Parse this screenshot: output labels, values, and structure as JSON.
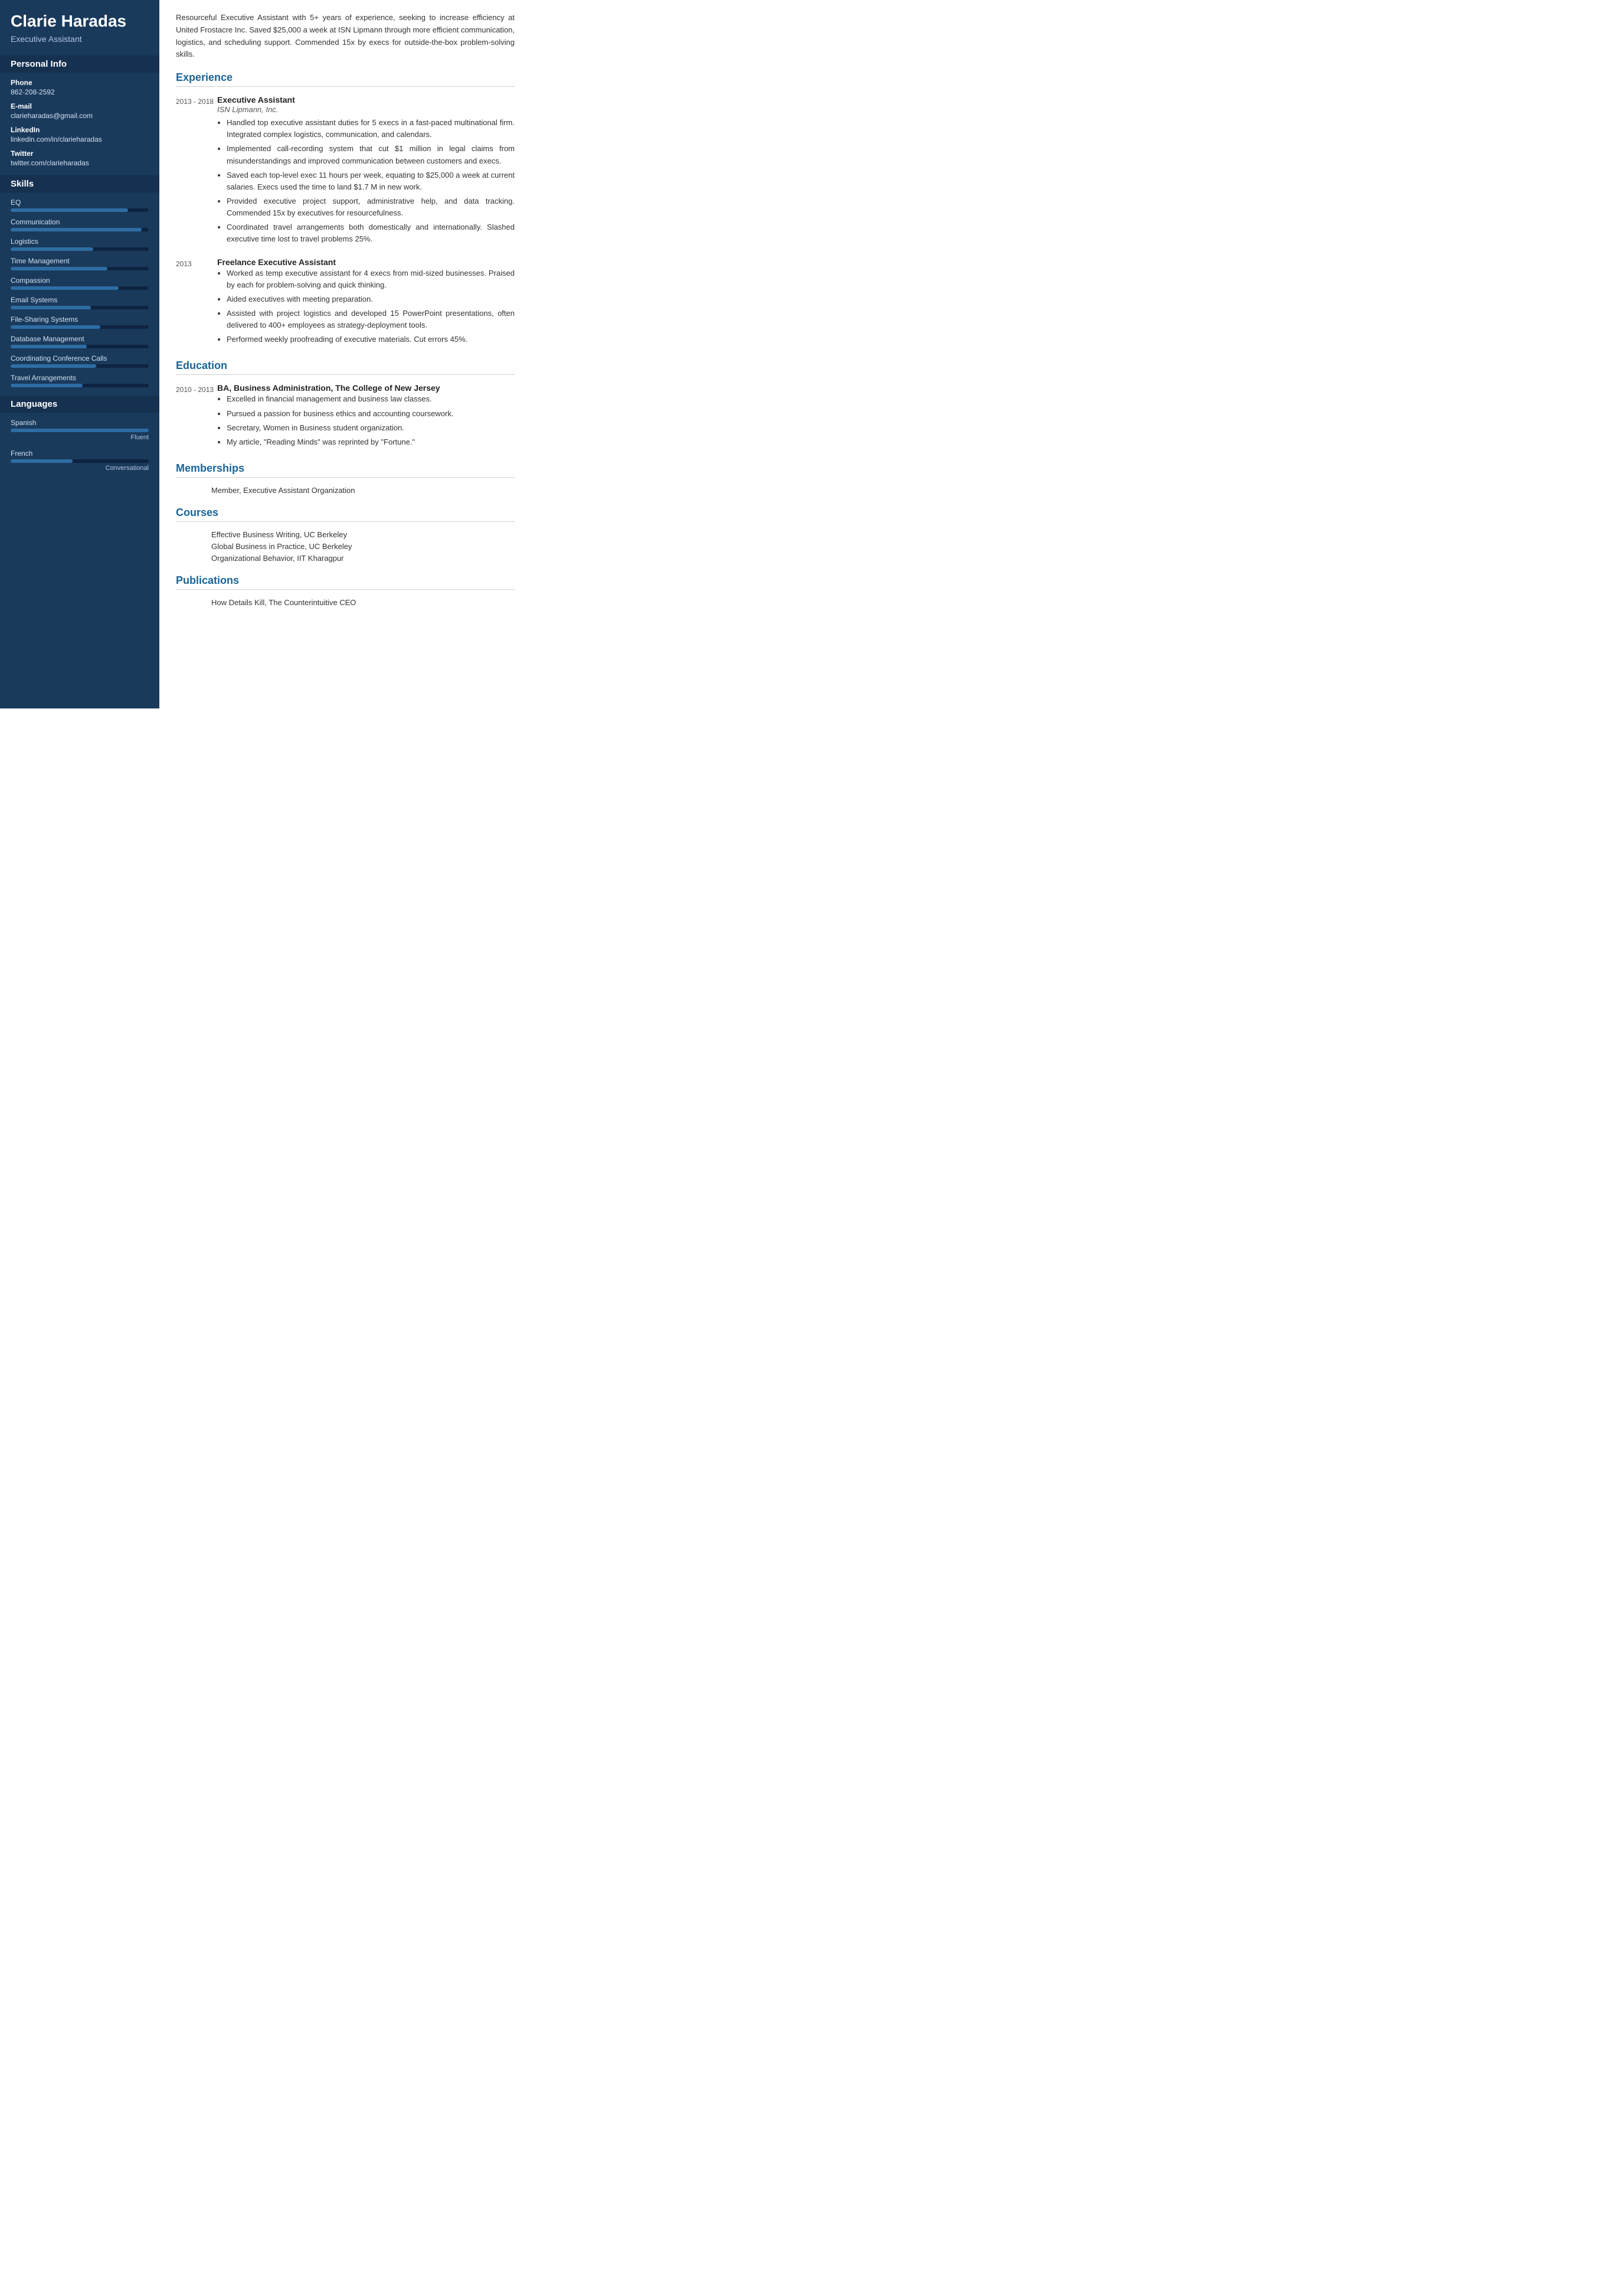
{
  "sidebar": {
    "name": "Clarie Haradas",
    "title": "Executive Assistant",
    "personal_info": {
      "section_title": "Personal Info",
      "phone_label": "Phone",
      "phone": "862-208-2592",
      "email_label": "E-mail",
      "email": "clarieharadas@gmail.com",
      "linkedin_label": "LinkedIn",
      "linkedin": "linkedin.com/in/clarieharadas",
      "twitter_label": "Twitter",
      "twitter": "twitter.com/clarieharadas"
    },
    "skills": {
      "section_title": "Skills",
      "items": [
        {
          "name": "EQ",
          "percent": 85
        },
        {
          "name": "Communication",
          "percent": 95
        },
        {
          "name": "Logistics",
          "percent": 60
        },
        {
          "name": "Time Management",
          "percent": 70
        },
        {
          "name": "Compassion",
          "percent": 78
        },
        {
          "name": "Email Systems",
          "percent": 58
        },
        {
          "name": "File-Sharing Systems",
          "percent": 65
        },
        {
          "name": "Database Management",
          "percent": 55
        },
        {
          "name": "Coordinating Conference Calls",
          "percent": 62
        },
        {
          "name": "Travel Arrangements",
          "percent": 52
        }
      ]
    },
    "languages": {
      "section_title": "Languages",
      "items": [
        {
          "name": "Spanish",
          "percent": 100,
          "level": "Fluent"
        },
        {
          "name": "French",
          "percent": 45,
          "level": "Conversational"
        }
      ]
    }
  },
  "main": {
    "summary": "Resourceful Executive Assistant with 5+ years of experience, seeking to increase efficiency at United Frostacre Inc. Saved $25,000 a week at ISN Lipmann through more efficient communication, logistics, and scheduling support. Commended 15x by execs for outside-the-box problem-solving skills.",
    "experience": {
      "section_title": "Experience",
      "entries": [
        {
          "date": "2013 - 2018",
          "title": "Executive Assistant",
          "org": "ISN Lipmann, Inc.",
          "bullets": [
            "Handled top executive assistant duties for 5 execs in a fast-paced multinational firm. Integrated complex logistics, communication, and calendars.",
            "Implemented call-recording system that cut $1 million in legal claims from misunderstandings and improved communication between customers and execs.",
            "Saved each top-level exec 11 hours per week, equating to $25,000 a week at current salaries. Execs used the time to land $1.7 M in new work.",
            "Provided executive project support, administrative help, and data tracking. Commended 15x by executives for resourcefulness.",
            "Coordinated travel arrangements both domestically and internationally. Slashed executive time lost to travel problems 25%."
          ]
        },
        {
          "date": "2013",
          "title": "Freelance Executive Assistant",
          "org": "",
          "bullets": [
            "Worked as temp executive assistant for 4 execs from mid-sized businesses. Praised by each for problem-solving and quick thinking.",
            "Aided executives with meeting preparation.",
            "Assisted with project logistics and developed 15 PowerPoint presentations, often delivered to 400+ employees as strategy-deployment tools.",
            "Performed weekly proofreading of executive materials. Cut errors 45%."
          ]
        }
      ]
    },
    "education": {
      "section_title": "Education",
      "entries": [
        {
          "date": "2010 - 2013",
          "title": "BA, Business Administration, The College of New Jersey",
          "org": "",
          "bullets": [
            "Excelled in financial management and business law classes.",
            "Pursued a passion for business ethics and accounting coursework.",
            "Secretary, Women in Business student organization.",
            "My article, \"Reading Minds\" was reprinted by \"Fortune.\""
          ]
        }
      ]
    },
    "memberships": {
      "section_title": "Memberships",
      "items": [
        "Member, Executive Assistant Organization"
      ]
    },
    "courses": {
      "section_title": "Courses",
      "items": [
        "Effective Business Writing, UC Berkeley",
        "Global Business in Practice, UC Berkeley",
        "Organizational Behavior, IIT Kharagpur"
      ]
    },
    "publications": {
      "section_title": "Publications",
      "items": [
        "How Details Kill, The Counterintuitive CEO"
      ]
    }
  }
}
